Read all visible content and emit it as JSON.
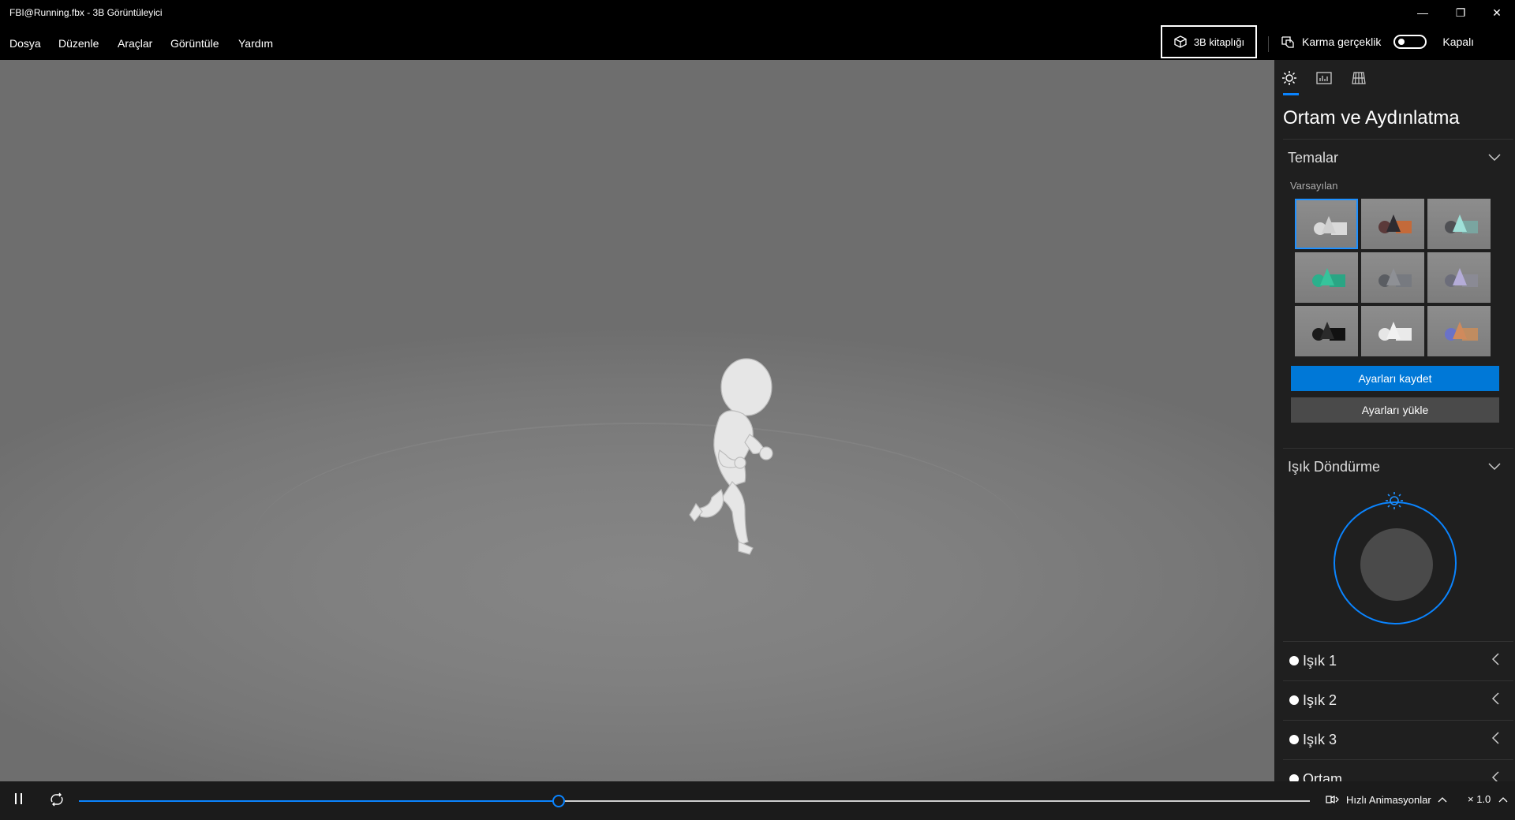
{
  "window": {
    "title": "FBI@Running.fbx - 3B Görüntüleyici",
    "controls": [
      "—",
      "❐",
      "✕"
    ]
  },
  "menu": {
    "items": [
      "Dosya",
      "Düzenle",
      "Araçlar",
      "Görüntüle",
      "Yardım"
    ],
    "library_button": "3B kitaplığı",
    "mixed_reality_label": "Karma gerçeklik",
    "toggle_state_label": "Kapalı"
  },
  "panel": {
    "tabs": [
      "sun-icon",
      "stats-icon",
      "grid-icon"
    ],
    "title": "Ortam ve Aydınlatma",
    "themes": {
      "title": "Temalar",
      "subtitle": "Varsayılan",
      "thumbnails": [
        {
          "c1": "#d9d9d9",
          "c2": "#cfcfcf",
          "c3": "#d9d9d9",
          "selected": true
        },
        {
          "c1": "#5b3a3a",
          "c2": "#2d2b30",
          "c3": "#c46a3a",
          "selected": false
        },
        {
          "c1": "#4f5054",
          "c2": "#9fe0d8",
          "c3": "#7aa5a0",
          "selected": false
        },
        {
          "c1": "#2bb08c",
          "c2": "#36c39b",
          "c3": "#2aa584",
          "selected": false
        },
        {
          "c1": "#5a5d62",
          "c2": "#8e9095",
          "c3": "#777a80",
          "selected": false
        },
        {
          "c1": "#6c6d7a",
          "c2": "#b4acd8",
          "c3": "#8a8a94",
          "selected": false
        },
        {
          "c1": "#1a1a1a",
          "c2": "#2a2a2a",
          "c3": "#111111",
          "selected": false
        },
        {
          "c1": "#e6e6e6",
          "c2": "#f1f1f1",
          "c3": "#eaeaea",
          "selected": false
        },
        {
          "c1": "#6a72c8",
          "c2": "#d08a5c",
          "c3": "#c08c60",
          "selected": false
        }
      ],
      "save_button": "Ayarları kaydet",
      "load_button": "Ayarları yükle"
    },
    "light_rotation": {
      "title": "Işık Döndürme"
    },
    "lights": [
      {
        "label": "Işık 1"
      },
      {
        "label": "Işık 2"
      },
      {
        "label": "Işık 3"
      },
      {
        "label": "Ortam"
      }
    ]
  },
  "bottombar": {
    "play_state": "pause-icon",
    "progress_fraction": 0.39,
    "quick_animations_label": "Hızlı Animasyonlar",
    "speed_label": "× 1.0"
  },
  "colors": {
    "accent": "#0a84ff",
    "primary_button": "#0078d7",
    "panel_bg": "#1f1f1f",
    "viewport_bg": "#7a7a7a"
  }
}
